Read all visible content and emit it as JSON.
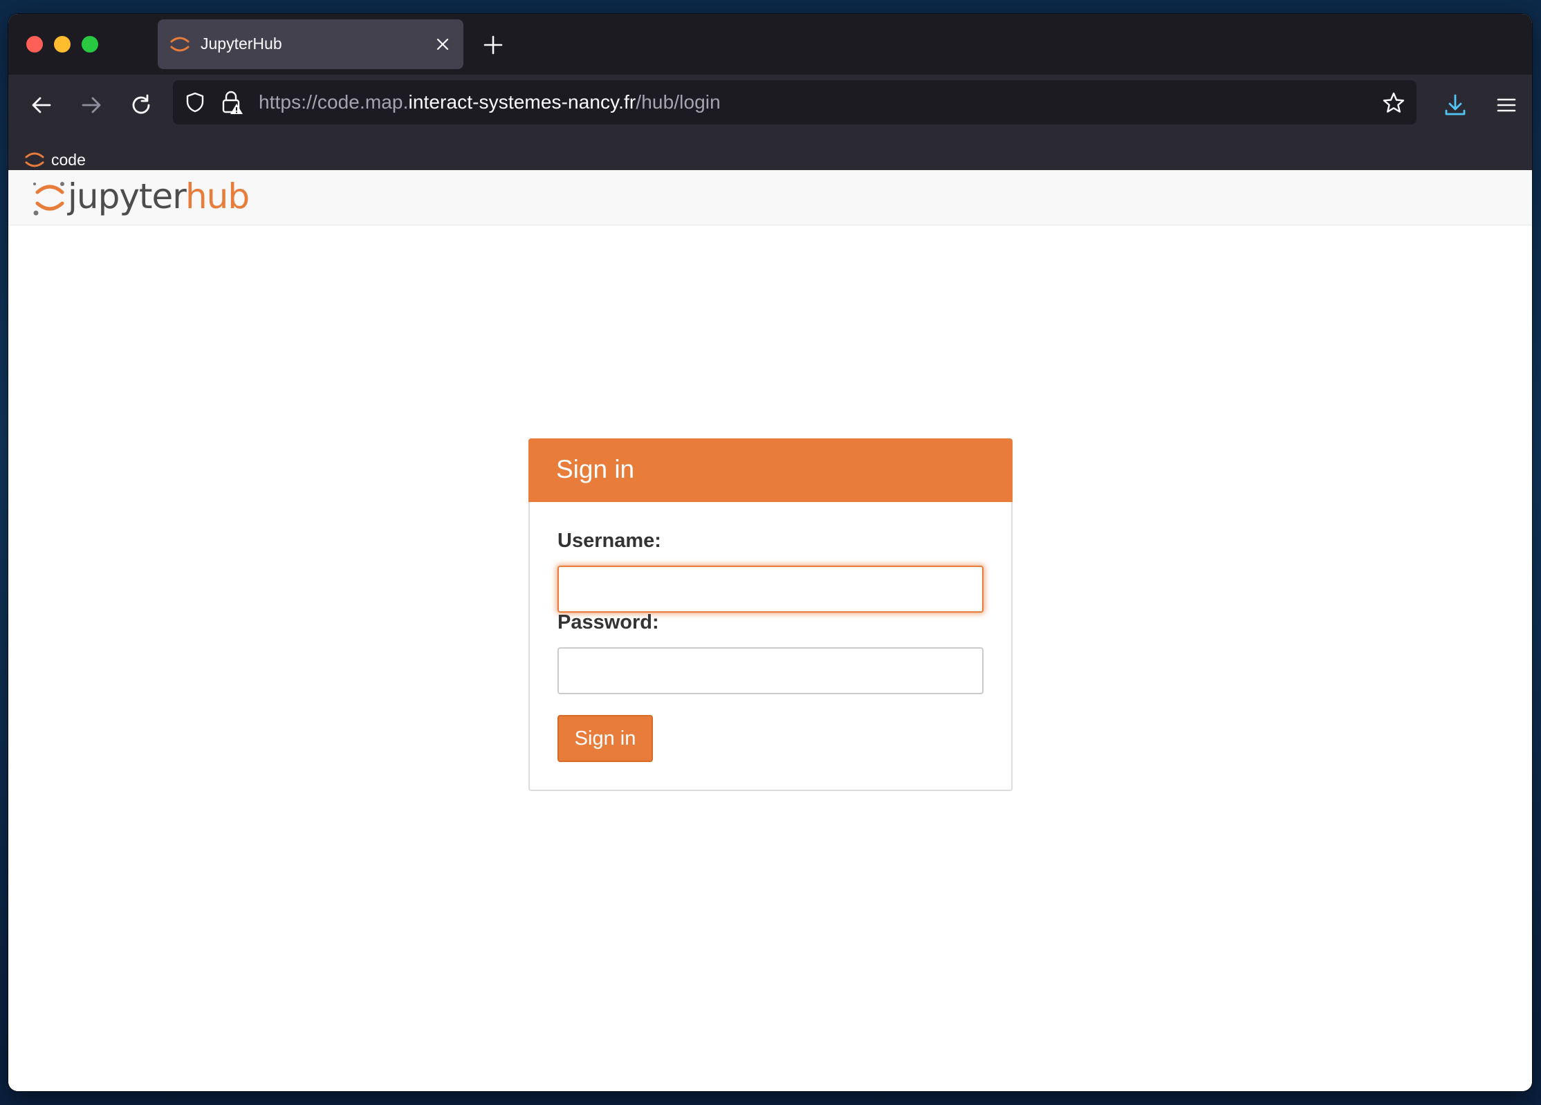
{
  "browser": {
    "tab": {
      "title": "JupyterHub",
      "icon": "jupyter-logo-icon"
    },
    "url": {
      "prefix": "https://code.map.",
      "domain": "interact-systemes-nancy.fr",
      "path": "/hub/login"
    },
    "bookmarks": [
      {
        "label": "code",
        "icon": "jupyter-logo-icon"
      }
    ],
    "icons": {
      "back": "arrow-left-icon",
      "forward": "arrow-right-icon",
      "reload": "reload-icon",
      "shield": "shield-icon",
      "lock": "lock-warning-icon",
      "star": "star-icon",
      "download": "download-icon",
      "menu": "hamburger-menu-icon"
    }
  },
  "header": {
    "wordmark_left": "jupyter",
    "wordmark_right": "hub"
  },
  "login": {
    "title": "Sign in",
    "username_label": "Username:",
    "username_value": "",
    "password_label": "Password:",
    "password_value": "",
    "submit_label": "Sign in"
  },
  "colors": {
    "accent": "#e77c3b",
    "tabbar": "#1c1b22",
    "navbar": "#2b2a33",
    "header_bg": "#f8f8f8",
    "download_icon": "#54c3f5"
  }
}
